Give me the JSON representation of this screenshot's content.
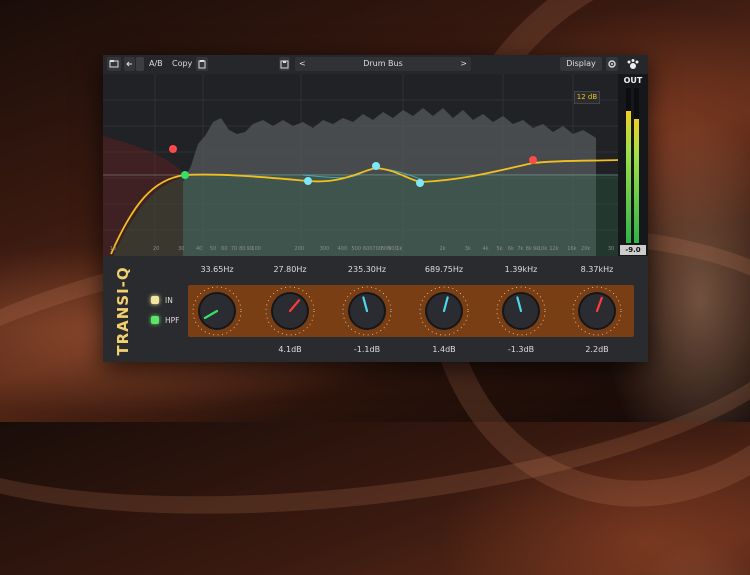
{
  "toolbar": {
    "ab_label": "A/B",
    "copy_label": "Copy",
    "preset_name": "Drum Bus",
    "prev_label": "<",
    "next_label": ">",
    "display_label": "Display"
  },
  "eq": {
    "range_label": "12 dB",
    "freq_ticks": [
      "10",
      "20",
      "30",
      "40",
      "50",
      "60",
      "70",
      "80",
      "90",
      "100",
      "200",
      "300",
      "400",
      "500",
      "600",
      "700",
      "800",
      "900",
      "1k",
      "2k",
      "3k",
      "4k",
      "5k",
      "6k",
      "7k",
      "8k",
      "9k",
      "10k",
      "12k",
      "16k",
      "20k",
      "30"
    ]
  },
  "output": {
    "label": "OUT",
    "value": "-9.0",
    "meter_level_left": 0.85,
    "meter_level_right": 0.8
  },
  "brand": "TRANSI-Q",
  "switches": [
    {
      "label": "IN",
      "on": true,
      "color": "#f3e6a0"
    },
    {
      "label": "HPF",
      "on": true,
      "color": "#5fe36a"
    }
  ],
  "bands": [
    {
      "freq": "33.65Hz",
      "gain": "",
      "pointer_color": "#38e06a",
      "angle": -120
    },
    {
      "freq": "27.80Hz",
      "gain": "4.1dB",
      "pointer_color": "#ff3b3b",
      "angle": 40
    },
    {
      "freq": "235.30Hz",
      "gain": "-1.1dB",
      "pointer_color": "#4ed6f0",
      "angle": -15
    },
    {
      "freq": "689.75Hz",
      "gain": "1.4dB",
      "pointer_color": "#4ed6f0",
      "angle": 15
    },
    {
      "freq": "1.39kHz",
      "gain": "-1.3dB",
      "pointer_color": "#4ed6f0",
      "angle": -15
    },
    {
      "freq": "8.37kHz",
      "gain": "2.2dB",
      "pointer_color": "#ff3b3b",
      "angle": 20
    }
  ],
  "colors": {
    "accent": "#f0c020",
    "panel": "#1c1d20",
    "knob_bg": "#7a3e14"
  }
}
